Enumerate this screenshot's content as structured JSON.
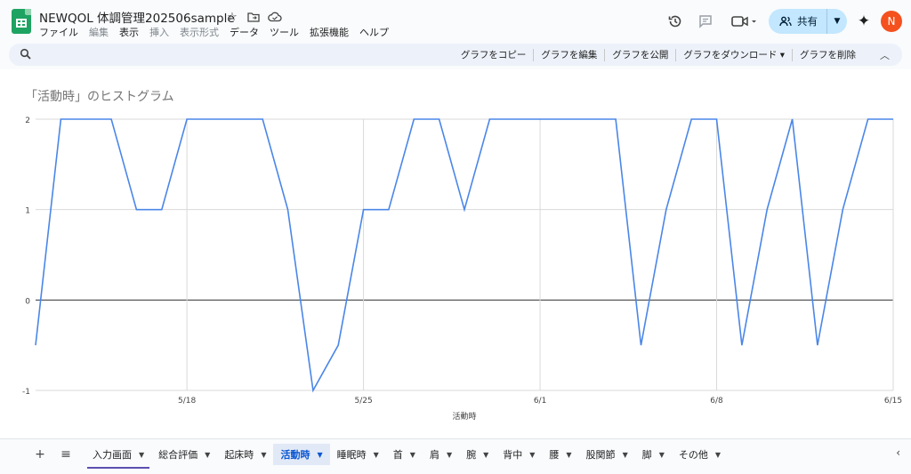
{
  "header": {
    "title": "NEWQOL 体調管理202506sample",
    "menu": [
      "ファイル",
      "編集",
      "表示",
      "挿入",
      "表示形式",
      "データ",
      "ツール",
      "拡張機能",
      "ヘルプ"
    ],
    "share_label": "共有",
    "avatar_initial": "N"
  },
  "toolbar": {
    "actions": [
      "グラフをコピー",
      "グラフを編集",
      "グラフを公開",
      "グラフをダウンロード ▾",
      "グラフを削除"
    ]
  },
  "chart_data": {
    "type": "line",
    "title": "「活動時」のヒストグラム",
    "xlabel": "活動時",
    "ylabel": "",
    "x_ticks": [
      "5/18",
      "5/25",
      "6/1",
      "6/8",
      "6/15"
    ],
    "y_ticks": [
      "2",
      "1",
      "0",
      "-1"
    ],
    "ylim": [
      -1,
      2
    ],
    "xlim": [
      "5/12",
      "6/15"
    ],
    "grid": true,
    "series_color": "#4a86e8",
    "x": [
      "5/12",
      "5/13",
      "5/14",
      "5/15",
      "5/16",
      "5/17",
      "5/18",
      "5/19",
      "5/20",
      "5/21",
      "5/22",
      "5/23",
      "5/24",
      "5/25",
      "5/26",
      "5/27",
      "5/28",
      "5/29",
      "5/30",
      "5/31",
      "6/1",
      "6/2",
      "6/3",
      "6/4",
      "6/5",
      "6/6",
      "6/7",
      "6/8",
      "6/9",
      "6/10",
      "6/11",
      "6/12",
      "6/13",
      "6/14",
      "6/15"
    ],
    "values": [
      -0.5,
      2,
      2,
      2,
      1,
      1,
      2,
      2,
      2,
      2,
      1,
      -1,
      -0.5,
      1,
      1,
      2,
      2,
      1,
      2,
      2,
      2,
      2,
      2,
      2,
      -0.5,
      1,
      2,
      2,
      -0.5,
      1,
      2,
      -0.5,
      1,
      2,
      2
    ]
  },
  "sheets": {
    "tabs": [
      "入力画面",
      "総合評価",
      "起床時",
      "活動時",
      "睡眠時",
      "首",
      "肩",
      "腕",
      "背中",
      "腰",
      "股関節",
      "脚",
      "その他"
    ],
    "selected": "活動時",
    "underlined": "入力画面"
  },
  "icons": {
    "star": "star-icon",
    "folder": "move-folder-icon",
    "cloud": "cloud-status-icon",
    "history": "history-icon",
    "comment": "comment-icon",
    "meet": "video-call-icon",
    "gemini": "sparkle-icon",
    "search": "search-icon"
  }
}
